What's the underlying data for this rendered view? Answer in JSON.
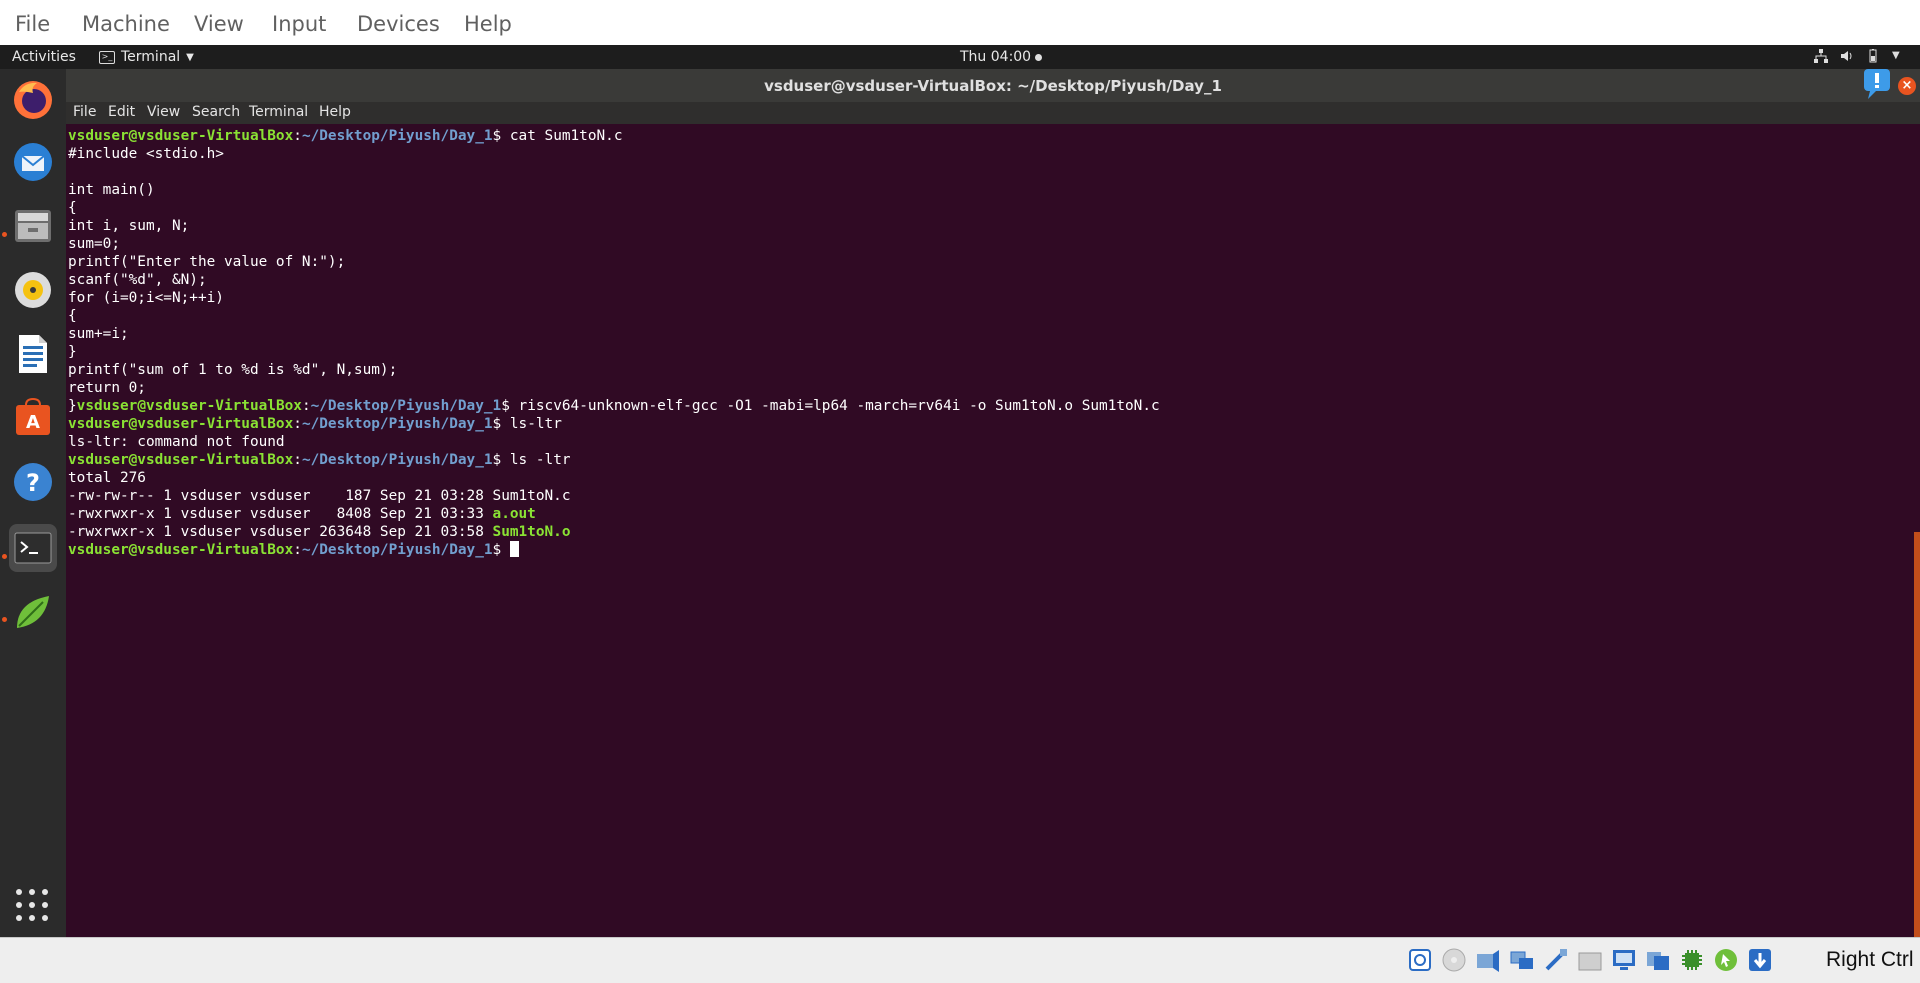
{
  "vbox_menu": [
    "File",
    "Machine",
    "View",
    "Input",
    "Devices",
    "Help"
  ],
  "topbar": {
    "activities": "Activities",
    "app_name": "Terminal",
    "clock": "Thu 04:00"
  },
  "window": {
    "title": "vsduser@vsduser-VirtualBox: ~/Desktop/Piyush/Day_1",
    "menu": [
      "File",
      "Edit",
      "View",
      "Search",
      "Terminal",
      "Help"
    ]
  },
  "dock": {
    "icons": [
      "firefox-icon",
      "thunderbird-icon",
      "files-icon",
      "rhythmbox-icon",
      "writer-icon",
      "software-icon",
      "help-icon",
      "terminal-icon",
      "leafpad-icon"
    ],
    "active": "terminal-icon",
    "show_apps_icon": "show-applications-icon"
  },
  "terminal": {
    "user_host": "vsduser@vsduser-VirtualBox",
    "path": "~/Desktop/Piyush/Day_1",
    "colors": {
      "user": "#8ae234",
      "path": "#729fcf",
      "background": "#300a24"
    },
    "lines": [
      {
        "type": "prompt",
        "cmd": "cat Sum1toN.c"
      },
      {
        "type": "text",
        "text": "#include <stdio.h>"
      },
      {
        "type": "text",
        "text": ""
      },
      {
        "type": "text",
        "text": "int main()"
      },
      {
        "type": "text",
        "text": "{"
      },
      {
        "type": "text",
        "text": "int i, sum, N;"
      },
      {
        "type": "text",
        "text": "sum=0;"
      },
      {
        "type": "text",
        "text": "printf(\"Enter the value of N:\");"
      },
      {
        "type": "text",
        "text": "scanf(\"%d\", &N);"
      },
      {
        "type": "text",
        "text": "for (i=0;i<=N;++i)"
      },
      {
        "type": "text",
        "text": "{"
      },
      {
        "type": "text",
        "text": "sum+=i;"
      },
      {
        "type": "text",
        "text": "}"
      },
      {
        "type": "text",
        "text": "printf(\"sum of 1 to %d is %d\", N,sum);"
      },
      {
        "type": "text",
        "text": "return 0;"
      },
      {
        "type": "prompt",
        "pre": "}",
        "cmd": "riscv64-unknown-elf-gcc -O1 -mabi=lp64 -march=rv64i -o Sum1toN.o Sum1toN.c"
      },
      {
        "type": "prompt",
        "cmd": "ls-ltr"
      },
      {
        "type": "text",
        "text": "ls-ltr: command not found"
      },
      {
        "type": "prompt",
        "cmd": "ls -ltr"
      },
      {
        "type": "text",
        "text": "total 276"
      },
      {
        "type": "file",
        "meta": "-rw-rw-r-- 1 vsduser vsduser    187 Sep 21 03:28 ",
        "name": "Sum1toN.c",
        "exec": false
      },
      {
        "type": "file",
        "meta": "-rwxrwxr-x 1 vsduser vsduser   8408 Sep 21 03:33 ",
        "name": "a.out",
        "exec": true
      },
      {
        "type": "file",
        "meta": "-rwxrwxr-x 1 vsduser vsduser 263648 Sep 21 03:58 ",
        "name": "Sum1toN.o",
        "exec": true
      },
      {
        "type": "prompt",
        "cmd": "",
        "cursor": true
      }
    ]
  },
  "status_bar": {
    "icons": [
      "harddisk-icon",
      "optical-drive-icon",
      "audio-icon",
      "network-icon",
      "usb-icon",
      "shared-folders-icon",
      "display-icon",
      "video-capture-icon",
      "cpu-icon",
      "mouse-integration-icon",
      "keyboard-capture-icon"
    ],
    "host_key": "Right Ctrl"
  }
}
